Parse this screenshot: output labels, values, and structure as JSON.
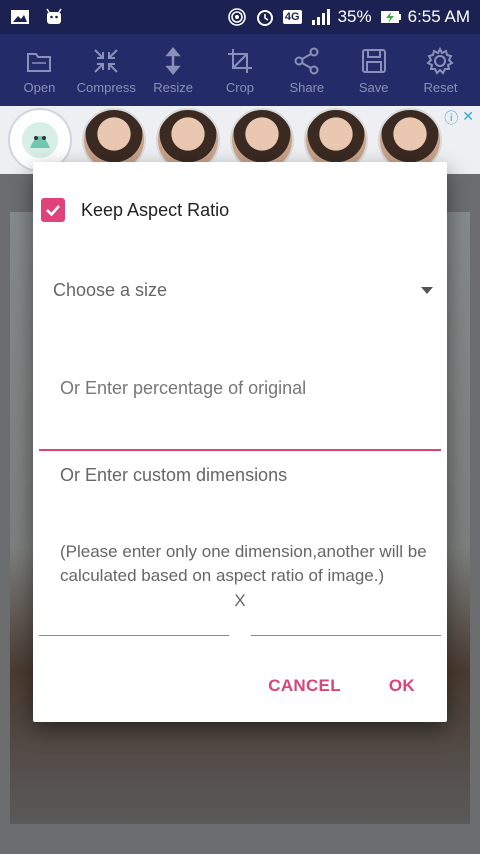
{
  "status_bar": {
    "battery": "35%",
    "time": "6:55 AM",
    "network": "4G"
  },
  "toolbar": {
    "items": [
      {
        "label": "Open",
        "icon": "folder-icon"
      },
      {
        "label": "Compress",
        "icon": "compress-icon"
      },
      {
        "label": "Resize",
        "icon": "resize-icon"
      },
      {
        "label": "Crop",
        "icon": "crop-icon"
      },
      {
        "label": "Share",
        "icon": "share-icon"
      },
      {
        "label": "Save",
        "icon": "save-icon"
      },
      {
        "label": "Reset",
        "icon": "reset-icon"
      }
    ]
  },
  "dialog": {
    "checkbox_label": "Keep Aspect Ratio",
    "checkbox_checked": true,
    "size_placeholder": "Choose a size",
    "percentage_hint": "Or Enter percentage of original",
    "custom_label": "Or Enter custom dimensions",
    "note": "(Please enter only one dimension,another will be calculated based on aspect ratio of image.)",
    "separator": "X",
    "cancel_label": "CANCEL",
    "ok_label": "OK"
  },
  "colors": {
    "accent": "#e0437a",
    "toolbar_bg": "#232c68",
    "status_bg": "#1b2252"
  }
}
